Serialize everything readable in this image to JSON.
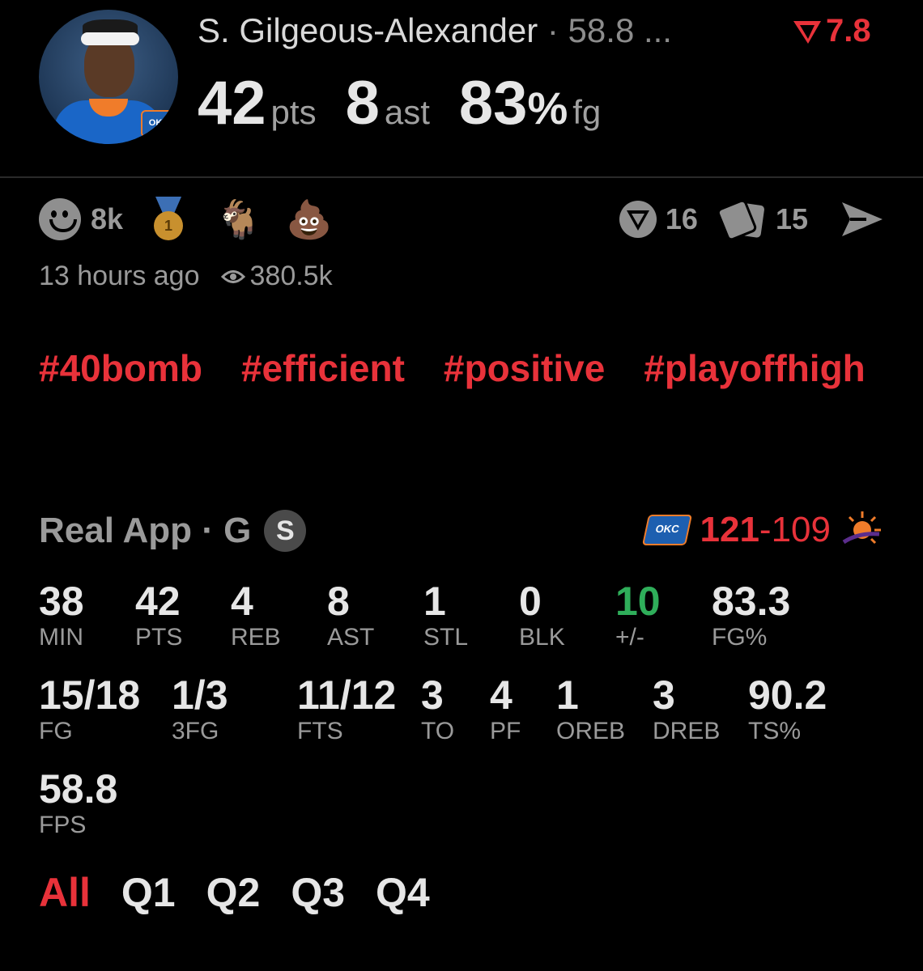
{
  "header": {
    "player_name": "S. Gilgeous-Alexander",
    "fps_short": " · 58.8 ...",
    "rating": "7.8",
    "points": "42",
    "points_unit": "pts",
    "assists": "8",
    "assists_unit": "ast",
    "fg_pct": "83",
    "fg_pct_symbol": "%",
    "fg_unit": "fg",
    "accent_color": "#e8323a"
  },
  "reactions": {
    "smile_icon": "smile-icon",
    "count": "8k",
    "medal_rank": "1"
  },
  "engagement": {
    "votes": "16",
    "cards": "15"
  },
  "meta": {
    "time_ago": "13 hours ago",
    "views": "380.5k"
  },
  "hashtags": [
    "#40bomb",
    "#efficient",
    "#positive",
    "#playoffhigh"
  ],
  "game": {
    "source": "Real App · G",
    "badge": "S",
    "team_logo": "OKC",
    "score_home": "121",
    "score_sep": "-",
    "score_away": "109"
  },
  "stats": {
    "row1": [
      {
        "value": "38",
        "label": "MIN"
      },
      {
        "value": "42",
        "label": "PTS"
      },
      {
        "value": "4",
        "label": "REB"
      },
      {
        "value": "8",
        "label": "AST"
      },
      {
        "value": "1",
        "label": "STL"
      },
      {
        "value": "0",
        "label": "BLK"
      },
      {
        "value": "10",
        "label": "+/-"
      },
      {
        "value": "83.3",
        "label": "FG%"
      }
    ],
    "row2": [
      {
        "value": "15/18",
        "label": "FG"
      },
      {
        "value": "1/3",
        "label": "3FG"
      },
      {
        "value": "11/12",
        "label": "FTS"
      },
      {
        "value": "3",
        "label": "TO"
      },
      {
        "value": "4",
        "label": "PF"
      },
      {
        "value": "1",
        "label": "OREB"
      },
      {
        "value": "3",
        "label": "DREB"
      },
      {
        "value": "90.2",
        "label": "TS%"
      }
    ],
    "row3": [
      {
        "value": "58.8",
        "label": "FPS"
      }
    ]
  },
  "tabs": [
    "All",
    "Q1",
    "Q2",
    "Q3",
    "Q4"
  ]
}
